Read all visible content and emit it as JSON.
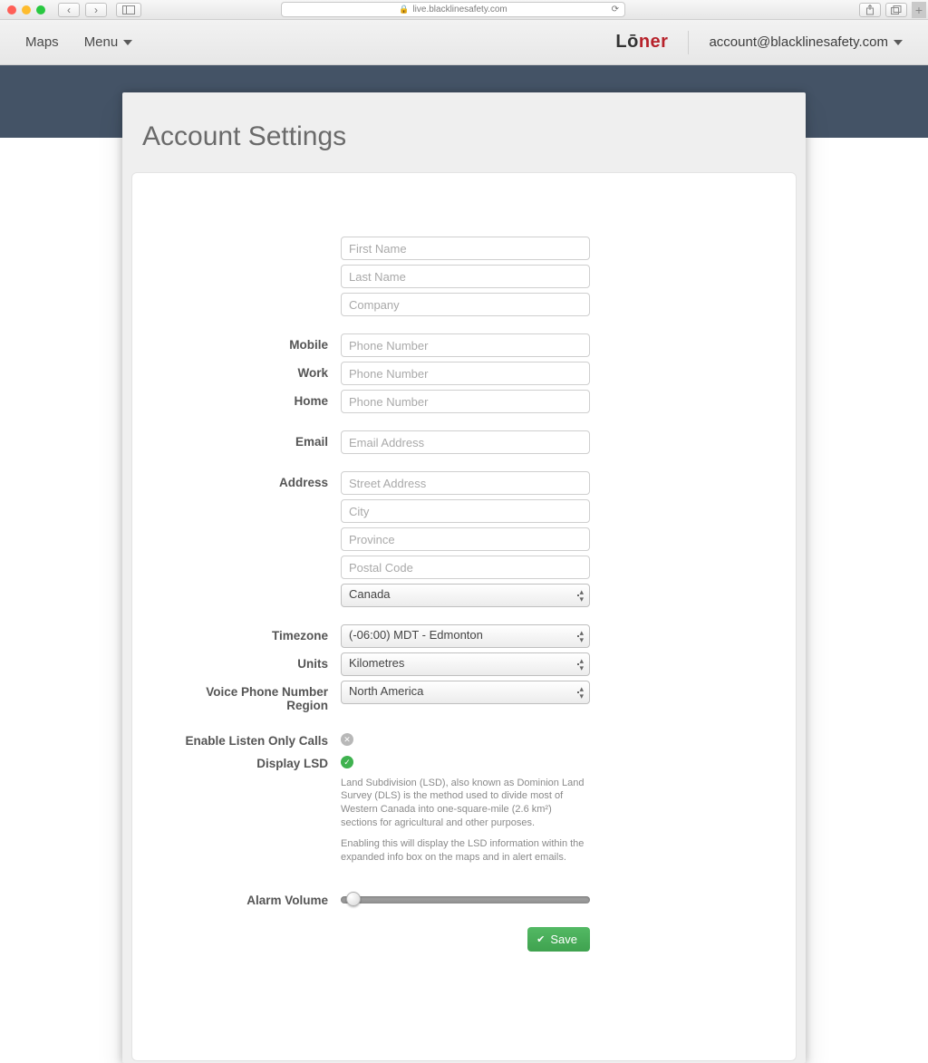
{
  "browser": {
    "url": "live.blacklinesafety.com"
  },
  "header": {
    "maps": "Maps",
    "menu": "Menu",
    "logo_lo": "Lō",
    "logo_ner": "ner",
    "account": "account@blacklinesafety.com"
  },
  "page": {
    "title": "Account Settings"
  },
  "placeholders": {
    "first_name": "First Name",
    "last_name": "Last Name",
    "company": "Company",
    "phone": "Phone Number",
    "email": "Email Address",
    "street": "Street Address",
    "city": "City",
    "province": "Province",
    "postal": "Postal Code"
  },
  "labels": {
    "mobile": "Mobile",
    "work": "Work",
    "home": "Home",
    "email": "Email",
    "address": "Address",
    "timezone": "Timezone",
    "units": "Units",
    "voice_region_l1": "Voice Phone Number",
    "voice_region_l2": "Region",
    "listen_only": "Enable Listen Only Calls",
    "display_lsd": "Display LSD",
    "alarm_volume": "Alarm Volume"
  },
  "selects": {
    "country": "Canada",
    "timezone": "(-06:00) MDT - Edmonton",
    "units": "Kilometres",
    "voice_region": "North America"
  },
  "toggles": {
    "listen_only_glyph": "✕",
    "display_lsd_glyph": "✓"
  },
  "help": {
    "lsd_p1": "Land Subdivision (LSD), also known as Dominion Land Survey (DLS) is the method used to divide most of Western Canada into one-square-mile (2.6 km²) sections for agricultural and other purposes.",
    "lsd_p2": "Enabling this will display the LSD information within the expanded info box on the maps and in alert emails."
  },
  "buttons": {
    "save": "Save"
  }
}
